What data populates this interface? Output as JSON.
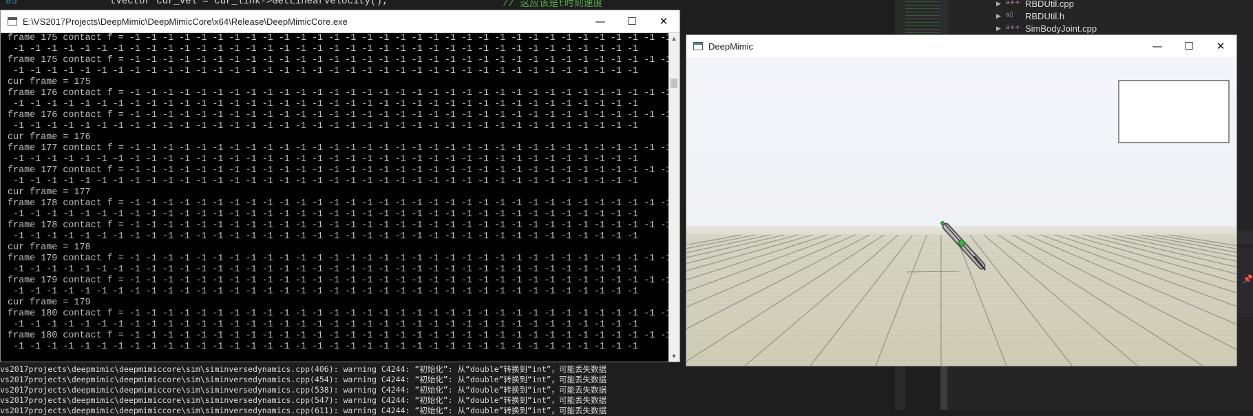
{
  "ide": {
    "line_number": "85",
    "code_line": "tVector cur_vel = cur_link->GetLinearVelocity();",
    "code_comment": "// 这应该是t时刻速度",
    "solution_items": [
      {
        "label": "RBDUtil.cpp",
        "icon": "cpp-file-icon"
      },
      {
        "label": "RBDUtil.h",
        "icon": "header-file-icon"
      },
      {
        "label": "SimBodyJoint.cpp",
        "icon": "cpp-file-icon"
      }
    ],
    "left_fragments": [
      "vs",
      "vs"
    ],
    "output_lines": [
      "vs2017projects\\deepmimic\\deepmimiccore\\sim\\siminversedynamics.cpp(406): warning C4244: “初始化”: 从“double”转换到“int”，可能丢失数据",
      "vs2017projects\\deepmimic\\deepmimiccore\\sim\\siminversedynamics.cpp(454): warning C4244: “初始化”: 从“double”转换到“int”，可能丢失数据",
      "vs2017projects\\deepmimic\\deepmimiccore\\sim\\siminversedynamics.cpp(538): warning C4244: “初始化”: 从“double”转换到“int”，可能丢失数据",
      "vs2017projects\\deepmimic\\deepmimiccore\\sim\\siminversedynamics.cpp(547): warning C4244: “初始化”: 从“double”转换到“int”，可能丢失数据",
      "vs2017projects\\deepmimic\\deepmimiccore\\sim\\siminversedynamics.cpp(611): warning C4244: “初始化”: 从“double”转换到“int”，可能丢失数据"
    ]
  },
  "console": {
    "title": "E:\\VS2017Projects\\DeepMimic\\DeepMimicCore\\x64\\Release\\DeepMimicCore.exe",
    "minimize": "—",
    "maximize": "☐",
    "close": "✕",
    "lines": [
      "frame 175 contact f = -1 -1 -1 -1 -1 -1 -1 -1 -1 -1 -1 -1 -1 -1 -1 -1 -1 -1 -1 -1 -1 -1 -1 -1 -1 -1 -1 -1 -1 -1 -1 -1 -1 -1 -1 -1 -1 -1",
      " -1 -1 -1 -1 -1 -1 -1 -1 -1 -1 -1 -1 -1 -1 -1 -1 -1 -1 -1 -1 -1 -1 -1 -1 -1 -1 -1 -1 -1 -1 -1 -1 -1 -1 -1 -1 -1 -1",
      "frame 175 contact f = -1 -1 -1 -1 -1 -1 -1 -1 -1 -1 -1 -1 -1 -1 -1 -1 -1 -1 -1 -1 -1 -1 -1 -1 -1 -1 -1 -1 -1 -1 -1 -1 -1 -1 -1 -1 -1 -1",
      " -1 -1 -1 -1 -1 -1 -1 -1 -1 -1 -1 -1 -1 -1 -1 -1 -1 -1 -1 -1 -1 -1 -1 -1 -1 -1 -1 -1 -1 -1 -1 -1 -1 -1 -1 -1 -1 -1",
      "cur frame = 175",
      "frame 176 contact f = -1 -1 -1 -1 -1 -1 -1 -1 -1 -1 -1 -1 -1 -1 -1 -1 -1 -1 -1 -1 -1 -1 -1 -1 -1 -1 -1 -1 -1 -1 -1 -1 -1 -1 -1 -1 -1 -1",
      " -1 -1 -1 -1 -1 -1 -1 -1 -1 -1 -1 -1 -1 -1 -1 -1 -1 -1 -1 -1 -1 -1 -1 -1 -1 -1 -1 -1 -1 -1 -1 -1 -1 -1 -1 -1 -1 -1",
      "frame 176 contact f = -1 -1 -1 -1 -1 -1 -1 -1 -1 -1 -1 -1 -1 -1 -1 -1 -1 -1 -1 -1 -1 -1 -1 -1 -1 -1 -1 -1 -1 -1 -1 -1 -1 -1 -1 -1 -1 -1",
      " -1 -1 -1 -1 -1 -1 -1 -1 -1 -1 -1 -1 -1 -1 -1 -1 -1 -1 -1 -1 -1 -1 -1 -1 -1 -1 -1 -1 -1 -1 -1 -1 -1 -1 -1 -1 -1 -1",
      "cur frame = 176",
      "frame 177 contact f = -1 -1 -1 -1 -1 -1 -1 -1 -1 -1 -1 -1 -1 -1 -1 -1 -1 -1 -1 -1 -1 -1 -1 -1 -1 -1 -1 -1 -1 -1 -1 -1 -1 -1 -1 -1 -1 -1",
      " -1 -1 -1 -1 -1 -1 -1 -1 -1 -1 -1 -1 -1 -1 -1 -1 -1 -1 -1 -1 -1 -1 -1 -1 -1 -1 -1 -1 -1 -1 -1 -1 -1 -1 -1 -1 -1 -1",
      "frame 177 contact f = -1 -1 -1 -1 -1 -1 -1 -1 -1 -1 -1 -1 -1 -1 -1 -1 -1 -1 -1 -1 -1 -1 -1 -1 -1 -1 -1 -1 -1 -1 -1 -1 -1 -1 -1 -1 -1 -1",
      " -1 -1 -1 -1 -1 -1 -1 -1 -1 -1 -1 -1 -1 -1 -1 -1 -1 -1 -1 -1 -1 -1 -1 -1 -1 -1 -1 -1 -1 -1 -1 -1 -1 -1 -1 -1 -1 -1",
      "cur frame = 177",
      "frame 178 contact f = -1 -1 -1 -1 -1 -1 -1 -1 -1 -1 -1 -1 -1 -1 -1 -1 -1 -1 -1 -1 -1 -1 -1 -1 -1 -1 -1 -1 -1 -1 -1 -1 -1 -1 -1 -1 -1 -1",
      " -1 -1 -1 -1 -1 -1 -1 -1 -1 -1 -1 -1 -1 -1 -1 -1 -1 -1 -1 -1 -1 -1 -1 -1 -1 -1 -1 -1 -1 -1 -1 -1 -1 -1 -1 -1 -1 -1",
      "frame 178 contact f = -1 -1 -1 -1 -1 -1 -1 -1 -1 -1 -1 -1 -1 -1 -1 -1 -1 -1 -1 -1 -1 -1 -1 -1 -1 -1 -1 -1 -1 -1 -1 -1 -1 -1 -1 -1 -1 -1",
      " -1 -1 -1 -1 -1 -1 -1 -1 -1 -1 -1 -1 -1 -1 -1 -1 -1 -1 -1 -1 -1 -1 -1 -1 -1 -1 -1 -1 -1 -1 -1 -1 -1 -1 -1 -1 -1 -1",
      "cur frame = 178",
      "frame 179 contact f = -1 -1 -1 -1 -1 -1 -1 -1 -1 -1 -1 -1 -1 -1 -1 -1 -1 -1 -1 -1 -1 -1 -1 -1 -1 -1 -1 -1 -1 -1 -1 -1 -1 -1 -1 -1 -1 -1",
      " -1 -1 -1 -1 -1 -1 -1 -1 -1 -1 -1 -1 -1 -1 -1 -1 -1 -1 -1 -1 -1 -1 -1 -1 -1 -1 -1 -1 -1 -1 -1 -1 -1 -1 -1 -1 -1 -1",
      "frame 179 contact f = -1 -1 -1 -1 -1 -1 -1 -1 -1 -1 -1 -1 -1 -1 -1 -1 -1 -1 -1 -1 -1 -1 -1 -1 -1 -1 -1 -1 -1 -1 -1 -1 -1 -1 -1 -1 -1 -1",
      " -1 -1 -1 -1 -1 -1 -1 -1 -1 -1 -1 -1 -1 -1 -1 -1 -1 -1 -1 -1 -1 -1 -1 -1 -1 -1 -1 -1 -1 -1 -1 -1 -1 -1 -1 -1 -1 -1",
      "cur frame = 179",
      "frame 180 contact f = -1 -1 -1 -1 -1 -1 -1 -1 -1 -1 -1 -1 -1 -1 -1 -1 -1 -1 -1 -1 -1 -1 -1 -1 -1 -1 -1 -1 -1 -1 -1 -1 -1 -1 -1 -1 -1 -1",
      " -1 -1 -1 -1 -1 -1 -1 -1 -1 -1 -1 -1 -1 -1 -1 -1 -1 -1 -1 -1 -1 -1 -1 -1 -1 -1 -1 -1 -1 -1 -1 -1 -1 -1 -1 -1 -1 -1",
      "frame 180 contact f = -1 -1 -1 -1 -1 -1 -1 -1 -1 -1 -1 -1 -1 -1 -1 -1 -1 -1 -1 -1 -1 -1 -1 -1 -1 -1 -1 -1 -1 -1 -1 -1 -1 -1 -1 -1 -1 -1",
      " -1 -1 -1 -1 -1 -1 -1 -1 -1 -1 -1 -1 -1 -1 -1 -1 -1 -1 -1 -1 -1 -1 -1 -1 -1 -1 -1 -1 -1 -1 -1 -1 -1 -1 -1 -1 -1 -1"
    ]
  },
  "deepmimic": {
    "title": "DeepMimic",
    "minimize": "—",
    "maximize": "☐",
    "close": "✕",
    "colors": {
      "sky": "#f4f5fb",
      "floor": "#cfcdb8",
      "floor_line": "#6d6d66",
      "character": "#8c8c8c",
      "marker": "#3cb043"
    }
  }
}
